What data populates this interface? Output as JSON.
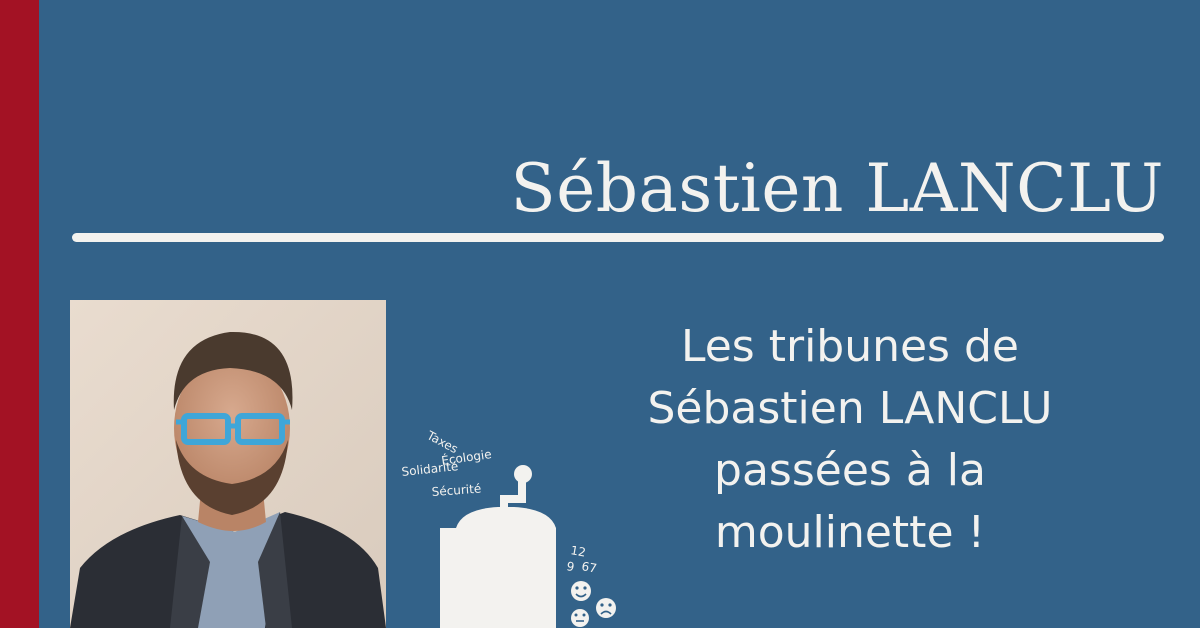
{
  "header": {
    "name": "Sébastien LANCLU"
  },
  "tagline": {
    "line1": "Les tribunes de",
    "line2": "Sébastien LANCLU",
    "line3": "passées à la",
    "line4": "moulinette !"
  },
  "grinder": {
    "words": [
      "Taxes",
      "Écologie",
      "Solidarité",
      "Sécurité"
    ],
    "numbers": [
      "12",
      "9",
      "67"
    ]
  },
  "colors": {
    "background": "#336289",
    "accent": "#a31224",
    "text": "#f3f2ef"
  }
}
